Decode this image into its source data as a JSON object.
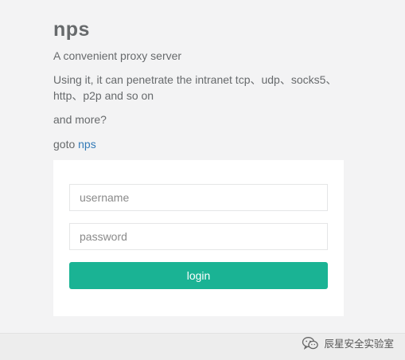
{
  "intro": {
    "logo": "nps",
    "tagline": "A convenient proxy server",
    "description": "Using it, it can penetrate the intranet tcp、udp、socks5、http、p2p and so on",
    "more": "and more?",
    "goto_prefix": "goto ",
    "goto_link": "nps"
  },
  "login": {
    "username_placeholder": "username",
    "password_placeholder": "password",
    "button_label": "login"
  },
  "watermark": {
    "icon": "wechat-icon",
    "text": "辰星安全实验室"
  },
  "colors": {
    "background": "#f3f3f4",
    "card": "#ffffff",
    "accent": "#1ab394",
    "link": "#337ab7",
    "text": "#676a6c"
  }
}
